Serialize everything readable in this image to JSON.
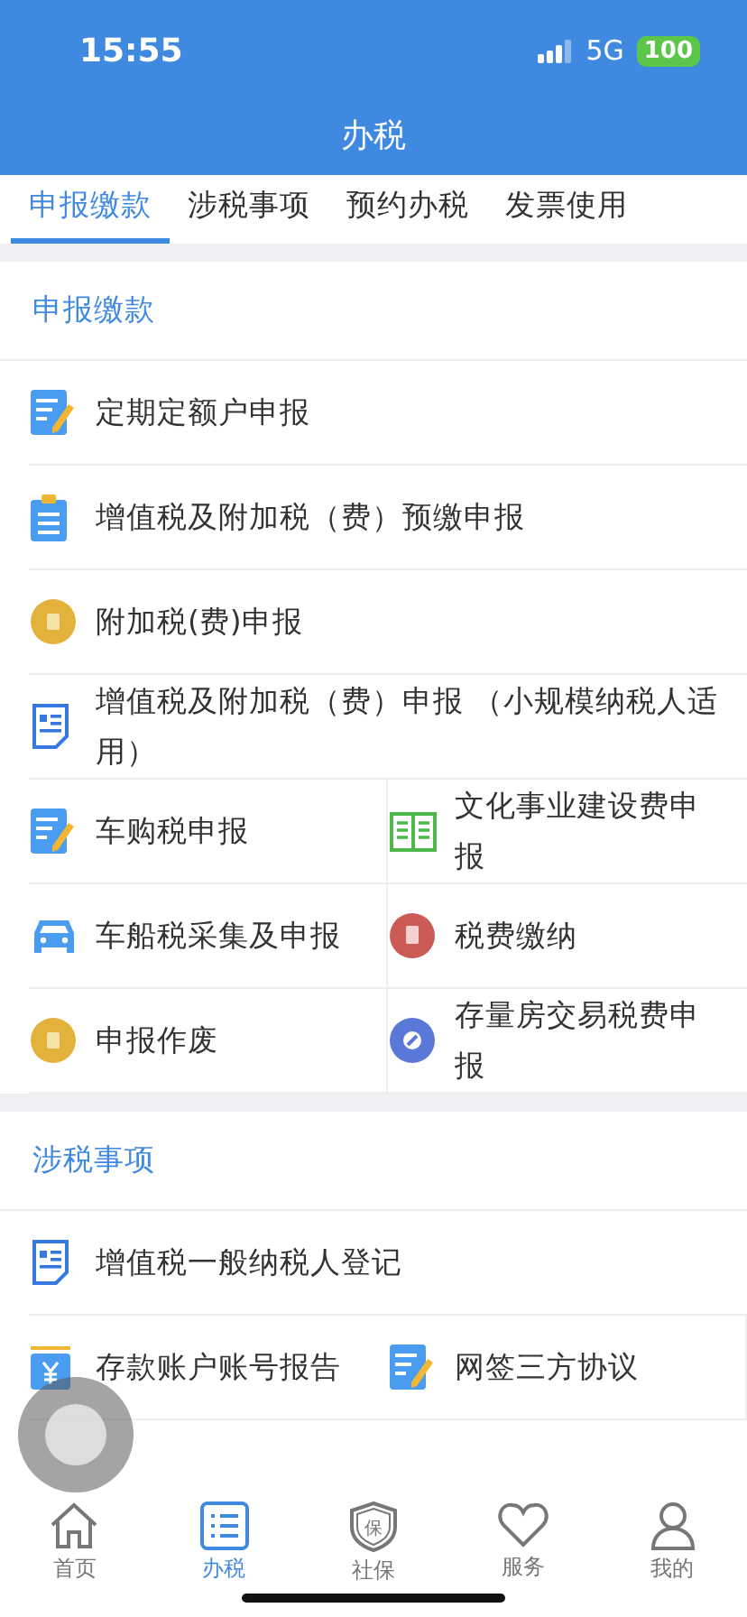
{
  "status_bar": {
    "time": "15:55",
    "network": "5G",
    "battery": "100"
  },
  "header": {
    "title": "办税"
  },
  "tabs": [
    {
      "label": "申报缴款",
      "selected": true
    },
    {
      "label": "涉税事项",
      "selected": false
    },
    {
      "label": "预约办税",
      "selected": false
    },
    {
      "label": "发票使用",
      "selected": false
    }
  ],
  "sections": [
    {
      "title": "申报缴款",
      "rows": [
        "定期定额户申报",
        "增值税及附加税（费）预缴申报",
        "附加税(费)申报",
        "增值税及附加税（费）申报 （小规模纳税人适用）"
      ],
      "grid_rows": [
        [
          "车购税申报",
          "文化事业建设费申报"
        ],
        [
          "车船税采集及申报",
          "税费缴纳"
        ],
        [
          "申报作废",
          "存量房交易税费申报"
        ]
      ]
    },
    {
      "title": "涉税事项",
      "rows": [
        "增值税一般纳税人登记"
      ],
      "grid_rows": [
        [
          "存款账户账号报告",
          "网签三方协议"
        ]
      ]
    }
  ],
  "nav": [
    {
      "label": "首页",
      "selected": false
    },
    {
      "label": "办税",
      "selected": true
    },
    {
      "label": "社保",
      "glyph": "保",
      "selected": false
    },
    {
      "label": "服务",
      "selected": false
    },
    {
      "label": "我的",
      "selected": false
    }
  ]
}
